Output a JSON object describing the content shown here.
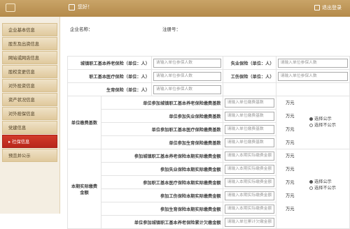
{
  "header": {
    "welcome_text": "您好！",
    "logout_label": "退出登录"
  },
  "sidebar": {
    "items": [
      {
        "label": "企业基本信息"
      },
      {
        "label": "股东及出资信息"
      },
      {
        "label": "网站或网店信息"
      },
      {
        "label": "股权变更信息"
      },
      {
        "label": "对外投资信息"
      },
      {
        "label": "资产状况信息"
      },
      {
        "label": "对外担保信息"
      },
      {
        "label": "党建信息"
      },
      {
        "label": "▸ 社保信息",
        "active": true
      },
      {
        "label": "预览并公示"
      }
    ]
  },
  "company": {
    "name_label": "企业名称：",
    "reg_label": "注册号："
  },
  "insured": {
    "urban_pension_label": "城镇职工基本养老保险（单位：人）",
    "unemployment_label": "失业保险（单位：人）",
    "medical_label": "职工基本医疗保险（单位：人）",
    "injury_label": "工伤保险（单位：人）",
    "maternity_label": "生育保险（单位：人）",
    "placeholder": "请输入单位参保人数"
  },
  "base": {
    "group_label": "单位缴费基数",
    "rows": [
      {
        "label": "单位参加城镇职工基本养老保险缴费基数",
        "placeholder": "请输入单位缴费基数",
        "unit": "万元"
      },
      {
        "label": "单位参加失业保险缴费基数",
        "placeholder": "请输入单位缴费基数",
        "unit": "万元"
      },
      {
        "label": "单位参加职工基本医疗保险缴费基数",
        "placeholder": "请输入单位缴费基数",
        "unit": "万元"
      },
      {
        "label": "单位参加生育保险缴费基数",
        "placeholder": "请输入单位缴费基数",
        "unit": "万元"
      }
    ],
    "radio_public": "选择公示",
    "radio_private": "选择不公示"
  },
  "paid": {
    "group_label": "本期实际缴费金额",
    "rows": [
      {
        "label": "参加城镇职工基本养老保险本期实际缴费金额",
        "placeholder": "请输入本期实际缴费金额",
        "unit": "万元"
      },
      {
        "label": "参加失业保险本期实际缴费金额",
        "placeholder": "请输入本期实际缴费金额",
        "unit": "万元"
      },
      {
        "label": "参加职工基本医疗保险本期实际缴费金额",
        "placeholder": "请输入本期实际缴费金额",
        "unit": "万元"
      },
      {
        "label": "参加工伤保险本期实际缴费金额",
        "placeholder": "请输入本期实际缴费金额",
        "unit": "万元"
      },
      {
        "label": "参加生育保险本期实际缴费金额",
        "placeholder": "请输入本期实际缴费金额",
        "unit": "万元"
      },
      {
        "label": "单位参加城镇职工基本养老保险累计欠缴金额",
        "placeholder": "请输入单位累计欠缴金额",
        "unit": "万元"
      }
    ],
    "radio_public": "选择公示",
    "radio_private": "选择不公示"
  }
}
